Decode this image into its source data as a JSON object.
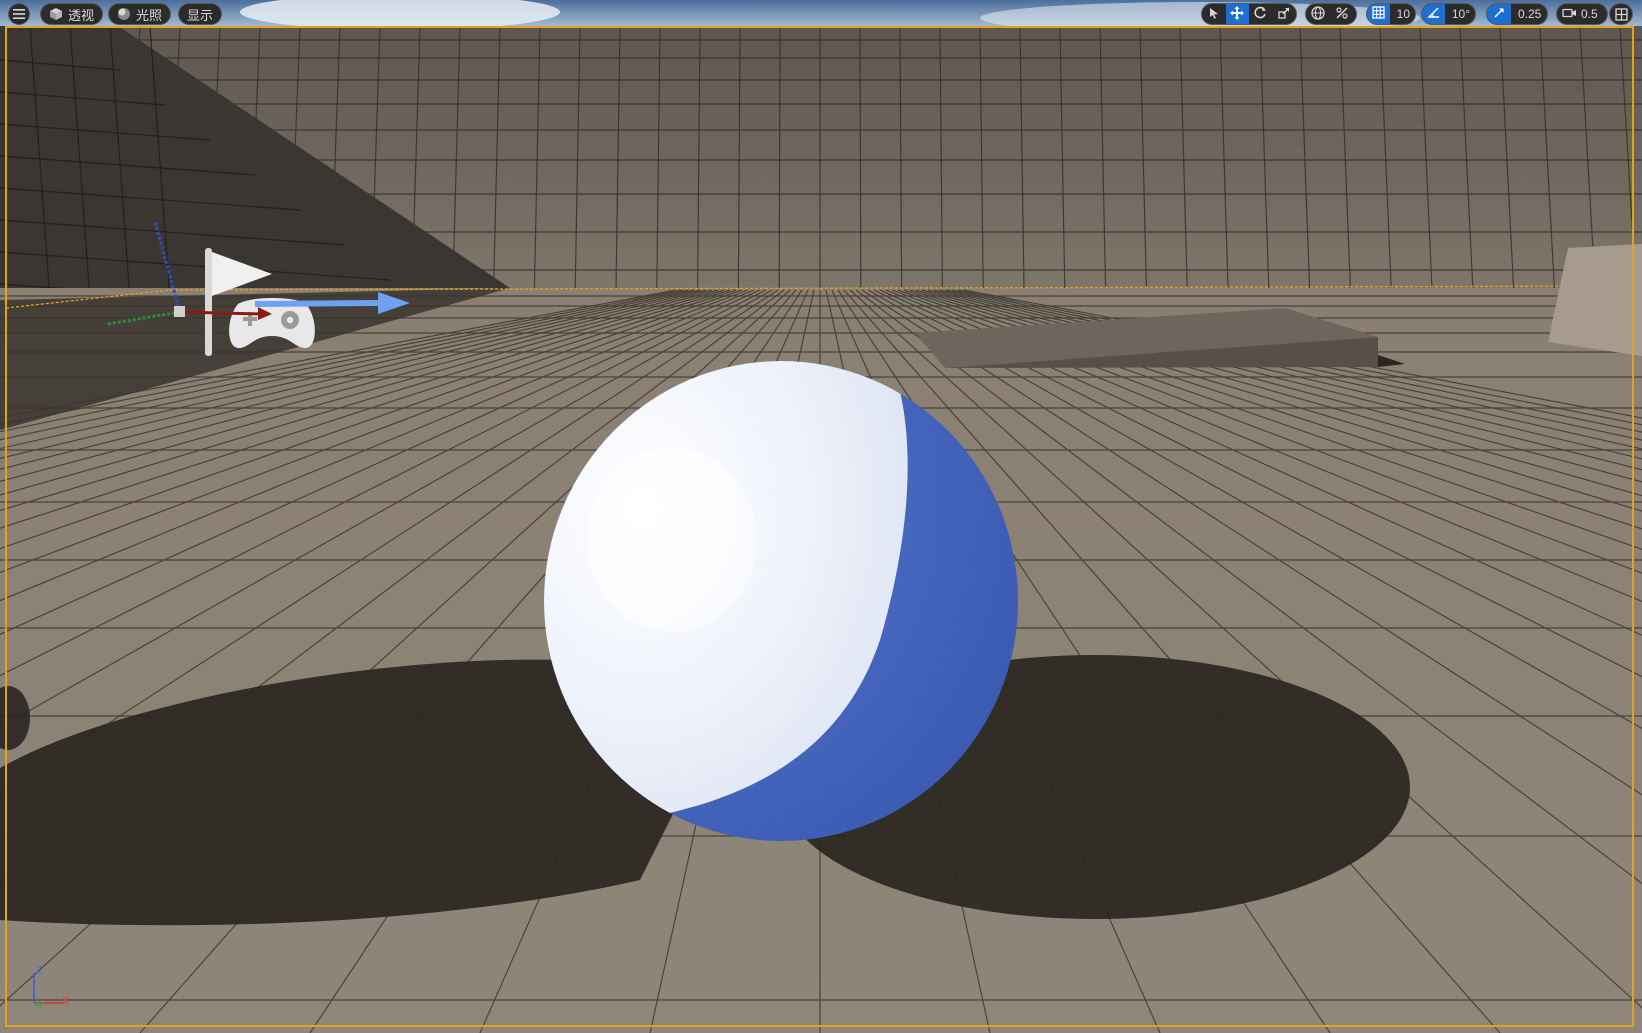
{
  "toolbar_left": {
    "menu_icon": "hamburger-menu-icon",
    "perspective_label": "透视",
    "lighting_label": "光照",
    "show_label": "显示"
  },
  "toolbar_right": {
    "select_tool": "cursor-select-icon",
    "translate_tool": "move-arrows-icon",
    "rotate_tool": "rotate-icon",
    "scale_tool": "scale-icon",
    "world_local": "globe-icon",
    "surface_snap": "surface-snap-icon",
    "grid_snap_value": "10",
    "rotation_snap_value": "10°",
    "scale_snap_value": "0.25",
    "camera_speed_value": "0.5",
    "layout_icon": "viewport-layout-icon"
  },
  "axis_gizmo": {
    "z": "Z",
    "y": "Y",
    "x": "X"
  },
  "colors": {
    "accent_active": "#1f6fd1",
    "selection_outline": "#e3a21a",
    "floor": "#8b7e70",
    "sphere_blue": "#4a6bc4",
    "sphere_white": "#f2f5fb"
  }
}
